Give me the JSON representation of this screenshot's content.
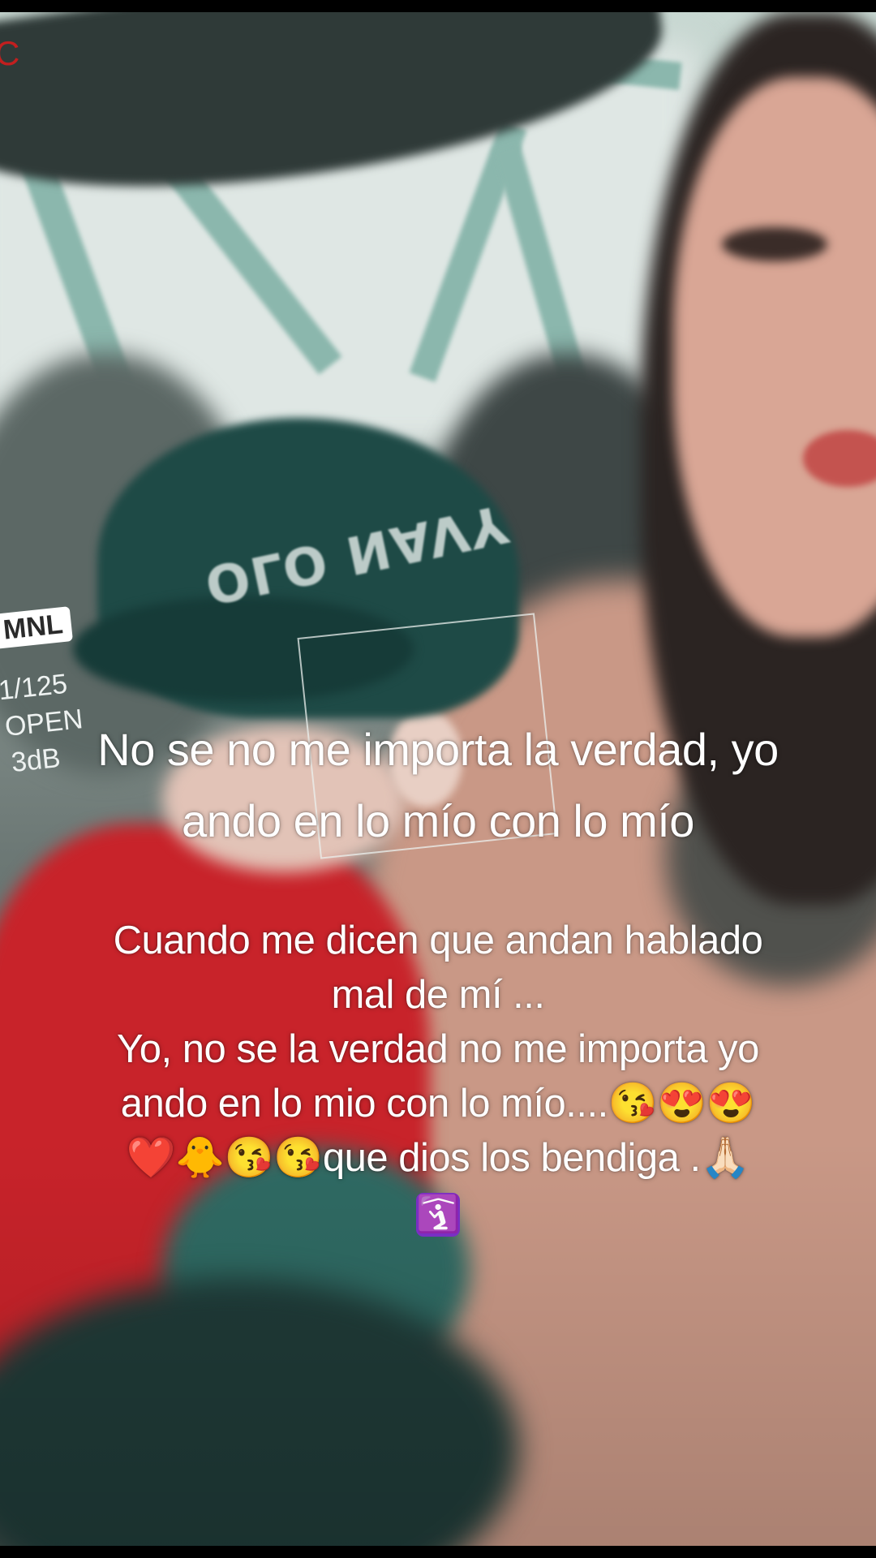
{
  "story": {
    "recording_indicator": "C",
    "camera": {
      "mode": "MNL",
      "shutter": "1/125",
      "aperture": "OPEN",
      "gain": "3dB"
    },
    "photo_text": "OLO NAVY",
    "caption_main": "No se no me importa la verdad, yo ando en lo mío con lo mío",
    "caption_body": [
      "Cuando me dicen que andan hablado mal de mí ...",
      "Yo, no se la verdad no me importa yo ando en lo mio con lo mío....😘😍😍",
      "❤️🐥😘😘que dios los bendiga .🙏🏻"
    ],
    "caption_tail_emoji": "🛐"
  },
  "colors": {
    "recording": "#c21f1f",
    "caption_text": "#ffffff",
    "cap_green": "#1e4a46",
    "shirt_red": "#c8232a"
  }
}
